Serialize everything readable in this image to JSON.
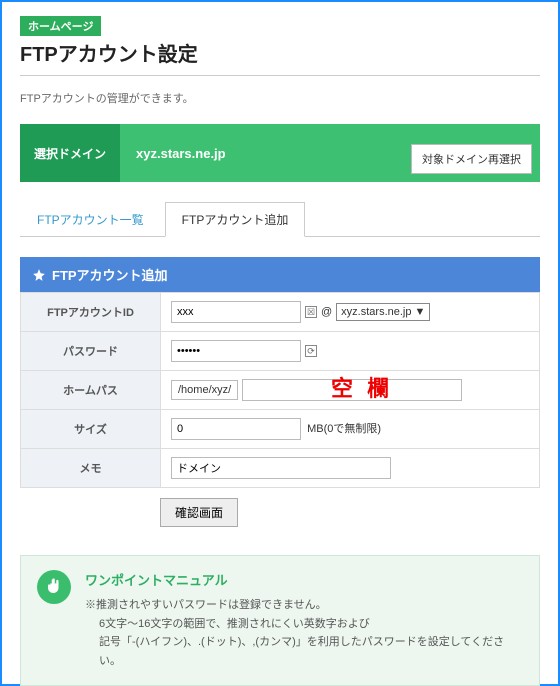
{
  "badge": "ホームページ",
  "title": "FTPアカウント設定",
  "description": "FTPアカウントの管理ができます。",
  "domain": {
    "label": "選択ドメイン",
    "value": "xyz.stars.ne.jp",
    "reselect": "対象ドメイン再選択"
  },
  "tabs": {
    "list": "FTPアカウント一覧",
    "add": "FTPアカウント追加"
  },
  "section_header": "FTPアカウント追加",
  "form": {
    "id_label": "FTPアカウントID",
    "id_value": "xxx",
    "at": "@",
    "domain_options": "xyz.stars.ne.jp ▼",
    "pw_label": "パスワード",
    "pw_value": "••••••",
    "homepath_label": "ホームパス",
    "homepath_prefix": "/home/xyz/",
    "homepath_value": "",
    "homepath_overlay": "空 欄",
    "size_label": "サイズ",
    "size_value": "0",
    "size_suffix": "MB(0で無制限)",
    "memo_label": "メモ",
    "memo_value": "ドメイン",
    "confirm_btn": "確認画面"
  },
  "tip": {
    "title": "ワンポイントマニュアル",
    "line1": "※推測されやすいパスワードは登録できません。",
    "line2": "6文字～16文字の範囲で、推測されにくい英数字および",
    "line3": "記号「-(ハイフン)、.(ドット)、,(カンマ)」を利用したパスワードを設定してください。"
  }
}
